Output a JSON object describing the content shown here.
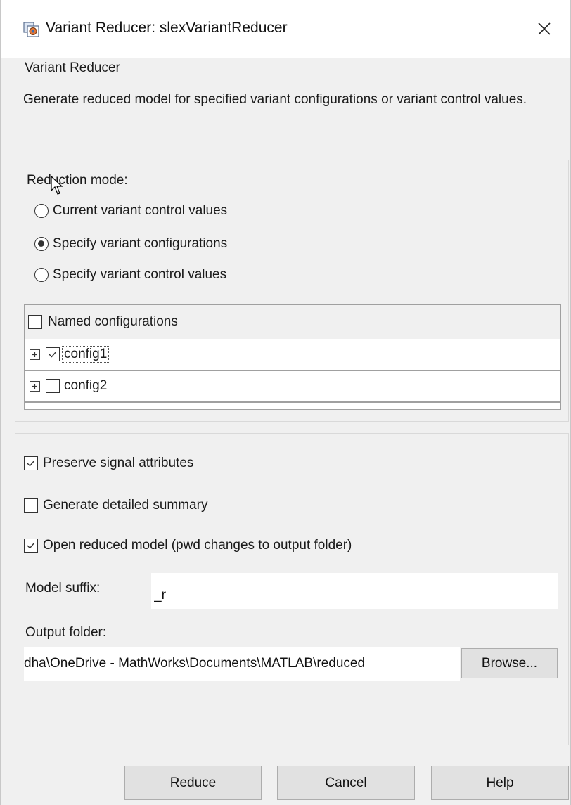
{
  "window": {
    "title": "Variant Reducer: slexVariantReducer",
    "icon": "simulink-model-icon"
  },
  "info": {
    "group_title": "Variant Reducer",
    "description": "Generate reduced model for specified variant configurations or variant control values."
  },
  "reduction": {
    "label": "Reduction mode:",
    "options": [
      {
        "label": "Current variant control values",
        "checked": false
      },
      {
        "label": "Specify variant configurations",
        "checked": true
      },
      {
        "label": "Specify variant control values",
        "checked": false
      }
    ]
  },
  "configurations": {
    "header": "Named configurations",
    "header_checked": false,
    "rows": [
      {
        "name": "config1",
        "checked": true
      },
      {
        "name": "config2",
        "checked": false
      }
    ]
  },
  "options": {
    "preserve_signal": {
      "label": "Preserve signal attributes",
      "checked": true
    },
    "detailed_summary": {
      "label": "Generate detailed summary",
      "checked": false
    },
    "open_reduced": {
      "label": "Open reduced model (pwd changes to output folder)",
      "checked": true
    }
  },
  "model_suffix": {
    "label": "Model suffix:",
    "value": "_r"
  },
  "output_folder": {
    "label": "Output folder:",
    "value": "dha\\OneDrive - MathWorks\\Documents\\MATLAB\\reduced",
    "browse_label": "Browse..."
  },
  "buttons": {
    "reduce": "Reduce",
    "cancel": "Cancel",
    "help": "Help"
  }
}
